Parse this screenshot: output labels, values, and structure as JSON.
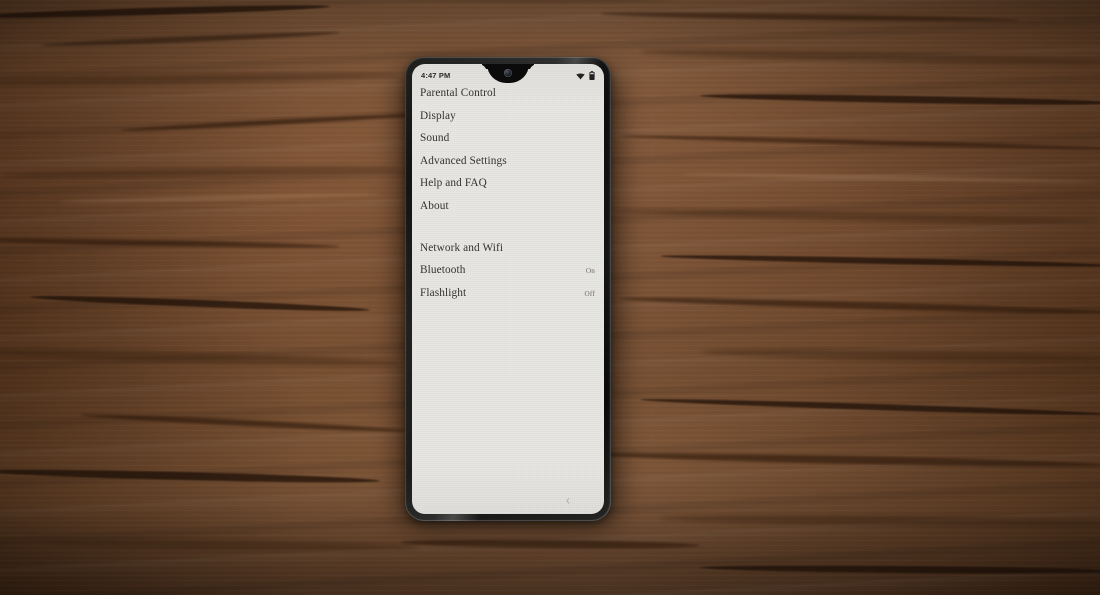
{
  "device": {
    "name": "smartphone",
    "screen_background": "#e8e7e3",
    "body_color": "#111111"
  },
  "background": {
    "surface": "wooden desk",
    "base_color": "#7a4c2c",
    "grain_color": "#2d180a"
  },
  "statusbar": {
    "time": "4:47 PM",
    "icons": [
      "wifi-icon",
      "battery-icon"
    ]
  },
  "menu": {
    "groups": [
      {
        "items": [
          {
            "label": "Parental Control",
            "value": ""
          },
          {
            "label": "Display",
            "value": ""
          },
          {
            "label": "Sound",
            "value": ""
          },
          {
            "label": "Advanced Settings",
            "value": ""
          },
          {
            "label": "Help and FAQ",
            "value": ""
          },
          {
            "label": "About",
            "value": ""
          }
        ]
      },
      {
        "items": [
          {
            "label": "Network and Wifi",
            "value": ""
          },
          {
            "label": "Bluetooth",
            "value": "On"
          },
          {
            "label": "Flashlight",
            "value": "Off"
          }
        ]
      }
    ]
  },
  "navbar": {
    "back_glyph": "‹"
  }
}
